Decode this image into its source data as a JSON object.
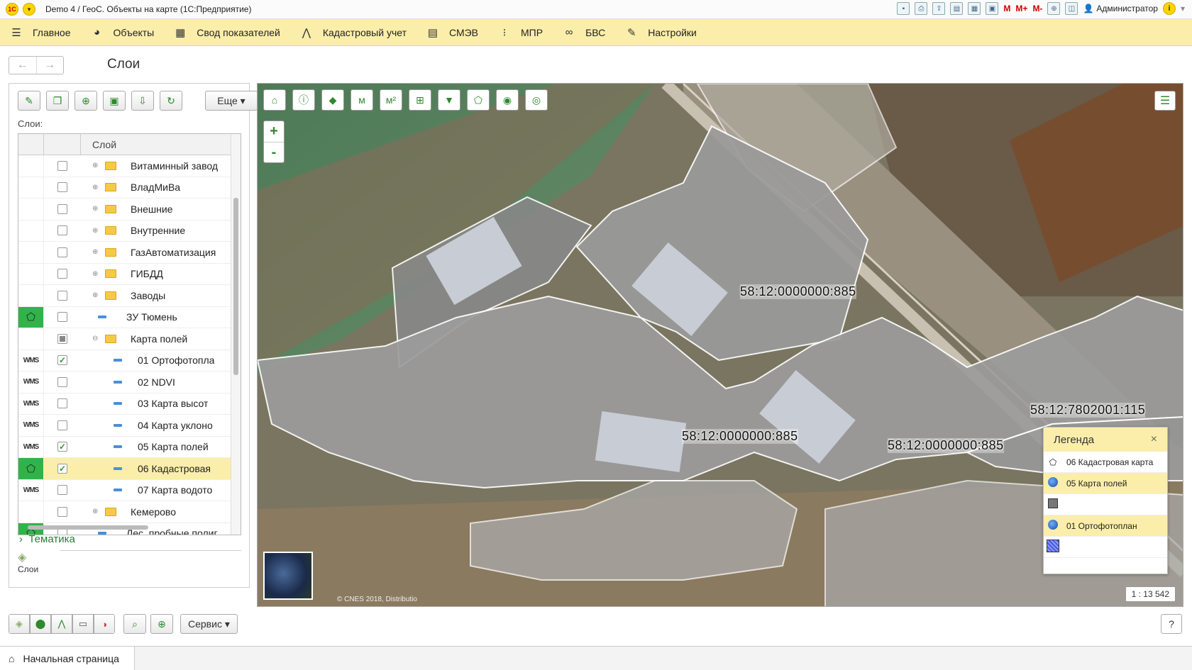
{
  "titlebar": {
    "title": "Demo 4 / ГеоС. Объекты на карте  (1С:Предприятие)",
    "user": "Администратор",
    "m_labels": [
      "M",
      "M+",
      "M-"
    ]
  },
  "mainmenu": [
    {
      "icon": "hamburger-icon",
      "label": "Главное"
    },
    {
      "icon": "globe-icon",
      "label": "Объекты"
    },
    {
      "icon": "table-icon",
      "label": "Свод показателей"
    },
    {
      "icon": "compass-icon",
      "label": "Кадастровый учет"
    },
    {
      "icon": "document-icon",
      "label": "СМЭВ"
    },
    {
      "icon": "chart-icon",
      "label": "МПР"
    },
    {
      "icon": "link-icon",
      "label": "БВС"
    },
    {
      "icon": "wrench-icon",
      "label": "Настройки"
    }
  ],
  "page": {
    "title": "Слои"
  },
  "leftpanel": {
    "more_button": "Еще",
    "layers_label": "Слои:",
    "column_header": "Слой",
    "rows": [
      {
        "type": "",
        "checked": "no",
        "kind": "folder",
        "expand": "⊕",
        "label": "Витаминный завод"
      },
      {
        "type": "",
        "checked": "no",
        "kind": "folder",
        "expand": "⊕",
        "label": "ВладМиВа"
      },
      {
        "type": "",
        "checked": "no",
        "kind": "folder",
        "expand": "⊕",
        "label": "Внешние"
      },
      {
        "type": "",
        "checked": "no",
        "kind": "folder",
        "expand": "⊕",
        "label": "Внутренние"
      },
      {
        "type": "",
        "checked": "no",
        "kind": "folder",
        "expand": "⊕",
        "label": "ГазАвтоматизация"
      },
      {
        "type": "",
        "checked": "no",
        "kind": "folder",
        "expand": "⊕",
        "label": "ГИБДД"
      },
      {
        "type": "",
        "checked": "no",
        "kind": "folder",
        "expand": "⊕",
        "label": "Заводы"
      },
      {
        "type": "polygon",
        "checked": "no",
        "kind": "leaf",
        "expand": "",
        "label": "ЗУ Тюмень"
      },
      {
        "type": "",
        "checked": "partial",
        "kind": "folder",
        "expand": "⊖",
        "label": "Карта полей"
      },
      {
        "type": "WMS",
        "checked": "yes",
        "kind": "subleaf",
        "expand": "",
        "label": "01 Ортофотопла"
      },
      {
        "type": "WMS",
        "checked": "no",
        "kind": "subleaf",
        "expand": "",
        "label": "02 NDVI"
      },
      {
        "type": "WMS",
        "checked": "no",
        "kind": "subleaf",
        "expand": "",
        "label": "03 Карта высот"
      },
      {
        "type": "WMS",
        "checked": "no",
        "kind": "subleaf",
        "expand": "",
        "label": "04 Карта уклоно"
      },
      {
        "type": "WMS",
        "checked": "yes",
        "kind": "subleaf",
        "expand": "",
        "label": "05 Карта полей"
      },
      {
        "type": "polygon",
        "checked": "yes",
        "kind": "subleaf",
        "expand": "",
        "label": "06 Кадастровая",
        "selected": true
      },
      {
        "type": "WMS",
        "checked": "no",
        "kind": "subleaf",
        "expand": "",
        "label": "07 Карта водото"
      },
      {
        "type": "",
        "checked": "no",
        "kind": "folder",
        "expand": "⊕",
        "label": "Кемерово"
      },
      {
        "type": "polygon",
        "checked": "no",
        "kind": "leaf",
        "expand": "",
        "label": "Лес_пробные полиг"
      }
    ],
    "tematika": "Тематика",
    "sloi_tab": "Слои"
  },
  "map": {
    "cadastral_labels": [
      "58:12:0000000:885",
      "58:12:0000000:885",
      "58:12:0000000:885",
      "58:12:7802001:115"
    ],
    "copyright": "© CNES 2018, Distributio",
    "scale": "1 : 13 542",
    "zoom_in": "+",
    "zoom_out": "-"
  },
  "legend": {
    "title": "Легенда",
    "close": "×",
    "items": [
      {
        "icon": "polygon-icon",
        "label": "06 Кадастровая карта"
      },
      {
        "icon": "globe-icon",
        "label": "05 Карта полей"
      },
      {
        "icon": "gray-square",
        "label": ""
      },
      {
        "icon": "globe-icon",
        "label": "01 Ортофотоплан"
      },
      {
        "icon": "blue-square",
        "label": ""
      }
    ]
  },
  "bottombar": {
    "service": "Сервис",
    "help": "?"
  },
  "statusbar": {
    "home_tab": "Начальная страница"
  }
}
